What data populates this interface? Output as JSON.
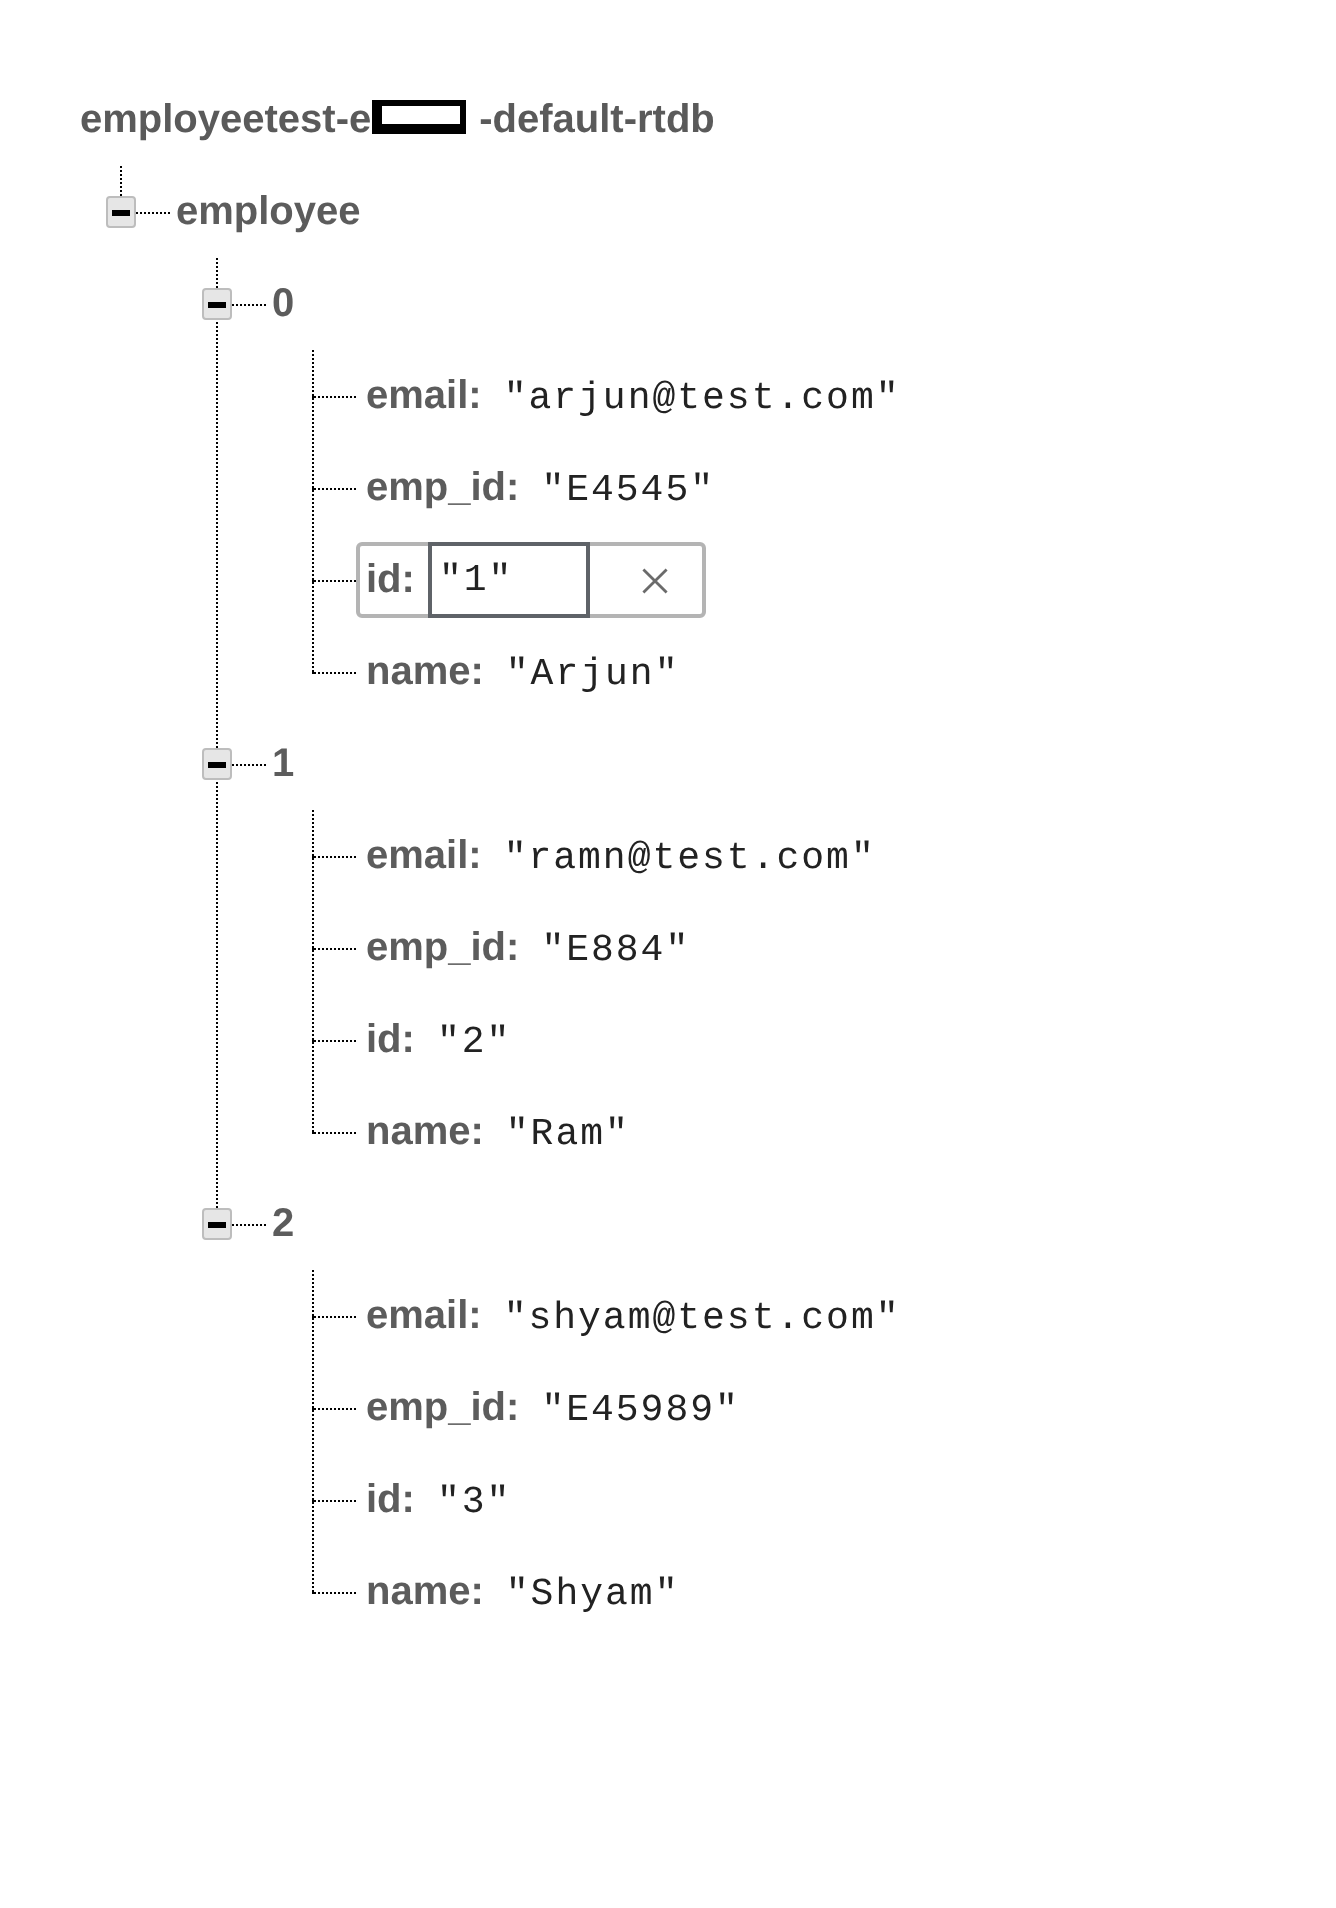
{
  "database": {
    "name_start": "employeetest-e",
    "redacted": true,
    "name_end": "-default-rtdb"
  },
  "tree": [
    {
      "kind": "node",
      "label": "employee",
      "expanded": true,
      "children": [
        {
          "kind": "node",
          "label": "0",
          "expanded": true,
          "children": [
            {
              "kind": "leaf",
              "key": "email:",
              "value": "\"arjun@test.com\"",
              "editing": false
            },
            {
              "kind": "leaf",
              "key": "emp_id:",
              "value": "\"E4545\"",
              "editing": false
            },
            {
              "kind": "leaf",
              "key": "id:",
              "value": "\"1\"",
              "editing": true
            },
            {
              "kind": "leaf",
              "key": "name:",
              "value": "\"Arjun\"",
              "editing": false
            }
          ]
        },
        {
          "kind": "node",
          "label": "1",
          "expanded": true,
          "children": [
            {
              "kind": "leaf",
              "key": "email:",
              "value": "\"ramn@test.com\"",
              "editing": false
            },
            {
              "kind": "leaf",
              "key": "emp_id:",
              "value": "\"E884\"",
              "editing": false
            },
            {
              "kind": "leaf",
              "key": "id:",
              "value": "\"2\"",
              "editing": false
            },
            {
              "kind": "leaf",
              "key": "name:",
              "value": "\"Ram\"",
              "editing": false
            }
          ]
        },
        {
          "kind": "node",
          "label": "2",
          "expanded": true,
          "children": [
            {
              "kind": "leaf",
              "key": "email:",
              "value": "\"shyam@test.com\"",
              "editing": false
            },
            {
              "kind": "leaf",
              "key": "emp_id:",
              "value": "\"E45989\"",
              "editing": false
            },
            {
              "kind": "leaf",
              "key": "id:",
              "value": "\"3\"",
              "editing": false
            },
            {
              "kind": "leaf",
              "key": "name:",
              "value": "\"Shyam\"",
              "editing": false
            }
          ]
        }
      ]
    }
  ]
}
